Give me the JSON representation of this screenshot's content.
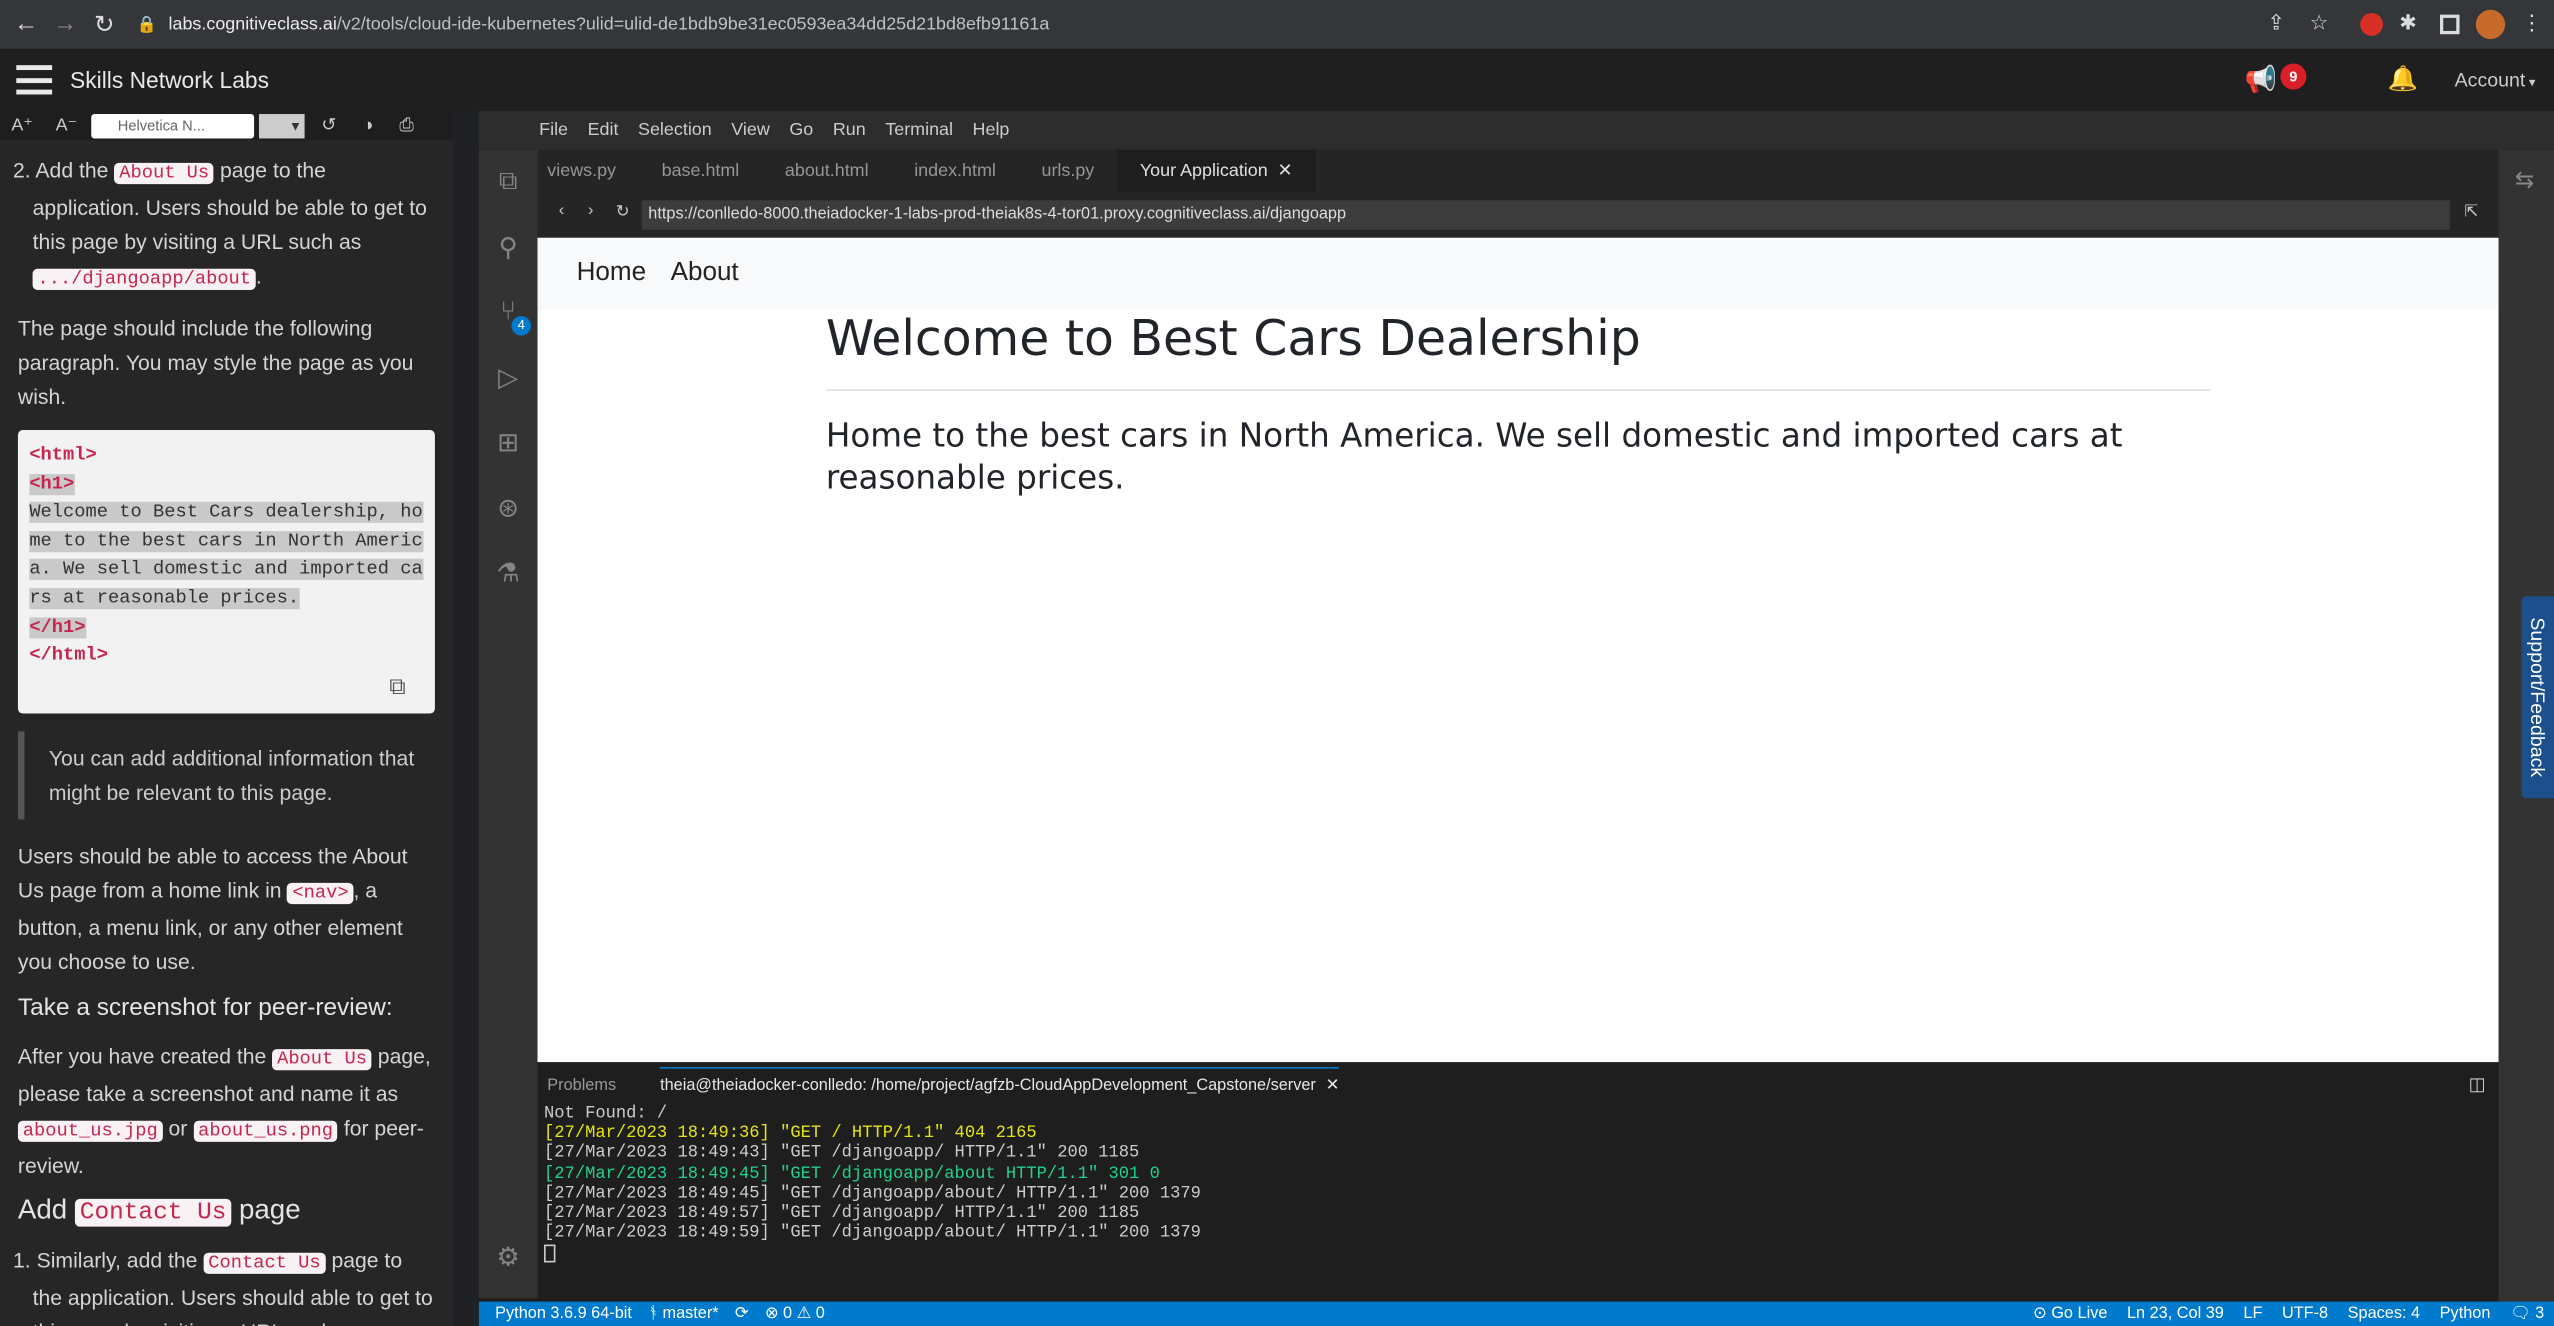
{
  "browser": {
    "host": "labs.cognitiveclass.ai",
    "path": "/v2/tools/cloud-ide-kubernetes?ulid=ulid-de1bdb9be31ec0593ea34dd25d21bd8efb91161a"
  },
  "header": {
    "title": "Skills Network Labs",
    "announce_badge": "9",
    "account_label": "Account"
  },
  "instructions": {
    "toolbar": {
      "font_up": "A⁺",
      "font_down": "A⁻",
      "font_select": "Helvetica N..."
    },
    "step2_num": "2.",
    "step2_pre": "Add the",
    "about_us_code": "About Us",
    "step2_post": "page to the application. Users should be able to get to this page by visiting a URL such as",
    "about_url": ".../djangoapp/about",
    "step2_end": ".",
    "para_include": "The page should include the following paragraph. You may style the page as you wish.",
    "snippet": {
      "line1": "<html>",
      "line2": "<h1>",
      "line3": "Welcome to Best Cars dealership, ho",
      "line4": "me to the best cars in North Americ",
      "line5": "a. We sell domestic and imported ca",
      "line6": "rs at reasonable prices.",
      "line7": "</h1>",
      "line8": "</html>"
    },
    "note": "You can add additional information that might be relevant to this page.",
    "access_pre": "Users should be able to access the About Us page from a home link in",
    "nav_code": "<nav>",
    "access_post": ", a button, a menu link, or any other element you choose to use.",
    "screenshot_heading": "Take a screenshot for peer-review:",
    "after_pre": "After you have created the",
    "after_code": "About Us",
    "after_post": "page, please take a screenshot and name it as",
    "jpg_code": "about_us.jpg",
    "or": "or",
    "png_code": "about_us.png",
    "for_peer": "for peer-review.",
    "add_heading_pre": "Add",
    "add_heading_code": "Contact Us",
    "add_heading_post": "page",
    "step1_num": "1.",
    "step1_pre": "Similarly, add the",
    "contact_code": "Contact Us",
    "step1_post": "page to the application. Users should able to get to this page by visiting a URL such as"
  },
  "ide": {
    "menu": [
      "File",
      "Edit",
      "Selection",
      "View",
      "Go",
      "Run",
      "Terminal",
      "Help"
    ],
    "tabs": [
      "views.py",
      "base.html",
      "about.html",
      "index.html",
      "urls.py",
      "Your Application"
    ],
    "scm_badge": "4",
    "preview_url": "https://conlledo-8000.theiadocker-1-labs-prod-theiak8s-4-tor01.proxy.cognitiveclass.ai/djangoapp",
    "page": {
      "nav_home": "Home",
      "nav_about": "About",
      "heading": "Welcome to Best Cars Dealership",
      "subheading": "Home to the best cars in North America. We sell domestic and imported cars at reasonable prices."
    },
    "panel": {
      "problems_tab": "Problems",
      "terminal_tab": "theia@theiadocker-conlledo: /home/project/agfzb-CloudAppDevelopment_Capstone/server",
      "lines": [
        "Not Found: /",
        "[27/Mar/2023 18:49:36] \"GET / HTTP/1.1\" 404 2165",
        "[27/Mar/2023 18:49:43] \"GET /djangoapp/ HTTP/1.1\" 200 1185",
        "[27/Mar/2023 18:49:45] \"GET /djangoapp/about HTTP/1.1\" 301 0",
        "[27/Mar/2023 18:49:45] \"GET /djangoapp/about/ HTTP/1.1\" 200 1379",
        "[27/Mar/2023 18:49:57] \"GET /djangoapp/ HTTP/1.1\" 200 1185",
        "[27/Mar/2023 18:49:59] \"GET /djangoapp/about/ HTTP/1.1\" 200 1379"
      ],
      "line_colors": [
        "#cccccc",
        "#e5e510",
        "#cccccc",
        "#23d18b",
        "#cccccc",
        "#cccccc",
        "#cccccc"
      ]
    },
    "status": {
      "python": "Python 3.6.9 64-bit",
      "branch": "master*",
      "problems": "⊗ 0 ⚠ 0",
      "golive": "Go Live",
      "position": "Ln 23, Col 39",
      "eol": "LF",
      "encoding": "UTF-8",
      "spaces": "Spaces: 4",
      "language": "Python",
      "notif": "3"
    },
    "support": "Support/Feedback"
  }
}
